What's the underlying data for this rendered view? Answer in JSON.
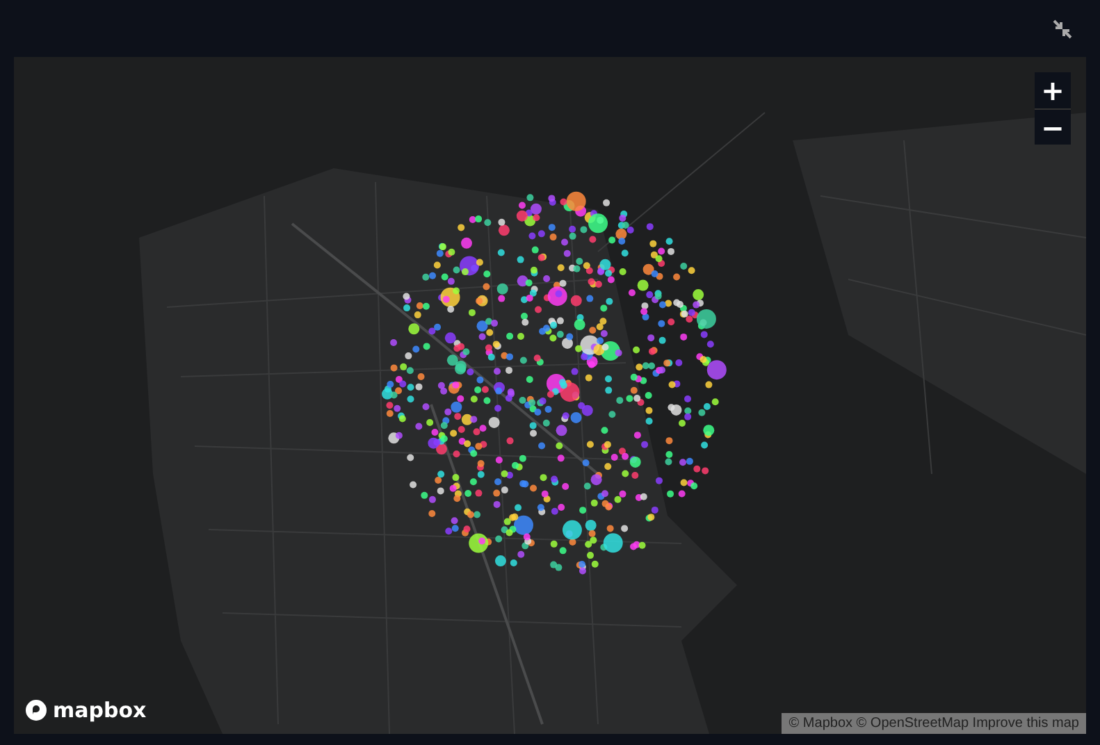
{
  "zoom_controls": [
    {
      "label": "+"
    },
    {
      "label": "−"
    }
  ],
  "logo": "mapbox",
  "attribution": "© Mapbox © OpenStreetMap Improve this map"
}
